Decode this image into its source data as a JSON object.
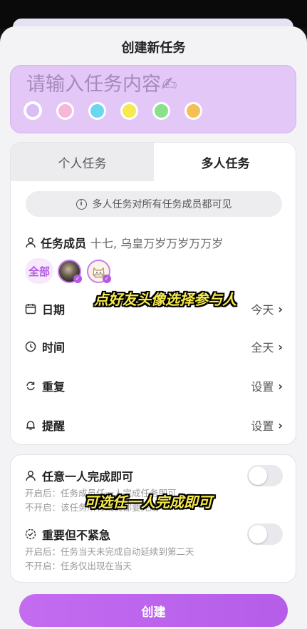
{
  "sheet": {
    "title": "创建新任务"
  },
  "task_input": {
    "placeholder": "请输入任务内容✍"
  },
  "colors": {
    "selected": "#d9bdf4",
    "options": [
      "#f7b7d8",
      "#6ad6f0",
      "#f6ea4e",
      "#8be08b",
      "#f6bf55"
    ],
    "accent": "#b25ae0"
  },
  "tabs": [
    {
      "label": "个人任务",
      "active": false
    },
    {
      "label": "多人任务",
      "active": true
    }
  ],
  "notice": {
    "icon": "info-icon",
    "text": "多人任务对所有任务成员都可见"
  },
  "members": {
    "label": "任务成员",
    "names": "十七, 乌皇万岁万岁万万岁",
    "all_label": "全部"
  },
  "rows": {
    "date": {
      "label": "日期",
      "value": "今天",
      "icon": "calendar-icon"
    },
    "time": {
      "label": "时间",
      "value": "全天",
      "icon": "clock-icon"
    },
    "repeat": {
      "label": "重复",
      "value": "设置",
      "icon": "repeat-icon"
    },
    "remind": {
      "label": "提醒",
      "value": "设置",
      "icon": "bell-icon"
    }
  },
  "options": {
    "anyone": {
      "title": "任意一人完成即可",
      "on_text": "开启后：任务成员任一人完成任务即可",
      "off_text": "不开启：该任务所有成员都要完成",
      "enabled": false
    },
    "important": {
      "title": "重要但不紧急",
      "on_text": "开启后：任务当天未完成自动延续到第二天",
      "off_text": "不开启：任务仅出现在当天",
      "enabled": false
    }
  },
  "create_button": {
    "label": "创建"
  },
  "captions": {
    "avatar_hint": "点好友头像选择参与人",
    "anyone_hint": "可选任一人完成即可"
  }
}
